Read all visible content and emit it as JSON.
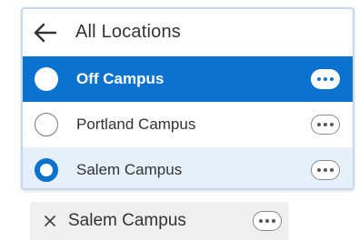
{
  "header": {
    "title": "All Locations",
    "back_icon": "arrow-left-icon"
  },
  "locations": [
    {
      "label": "Off Campus",
      "state": "highlighted"
    },
    {
      "label": "Portland Campus",
      "state": "unselected"
    },
    {
      "label": "Salem Campus",
      "state": "selected"
    }
  ],
  "selection_chip": {
    "label": "Salem Campus",
    "close_icon": "close-icon"
  },
  "colors": {
    "accent": "#0b73ce",
    "selected_bg": "#e6f0fa",
    "chip_bg": "#efefef"
  }
}
